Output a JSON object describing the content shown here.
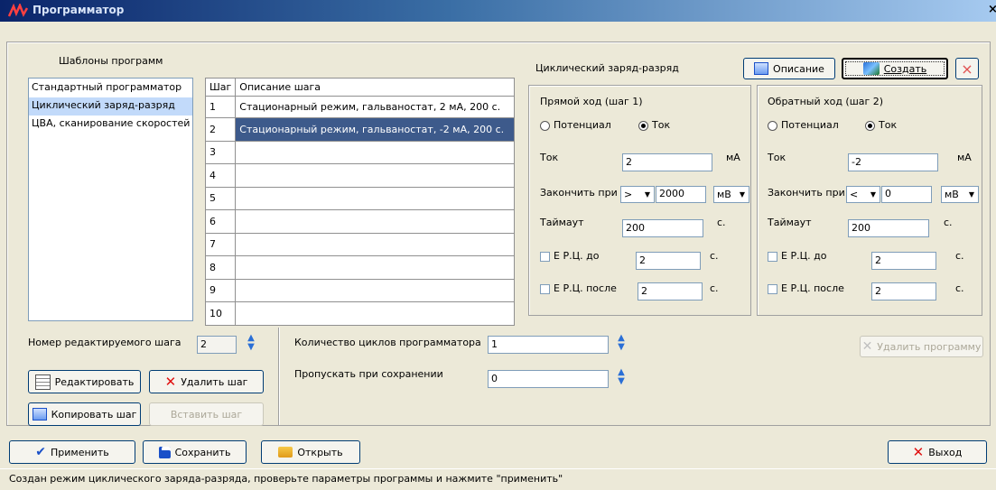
{
  "window": {
    "title": "Программатор"
  },
  "templates": {
    "label": "Шаблоны программ",
    "items": [
      "Стандартный программатор",
      "Циклический заряд-разряд",
      "ЦВА, сканирование скоростей"
    ],
    "selected_index": 1
  },
  "steps": {
    "col_step": "Шаг",
    "col_desc": "Описание шага",
    "rows": [
      {
        "n": "1",
        "desc": "Стационарный режим,  гальваностат, 2 мА, 200 с."
      },
      {
        "n": "2",
        "desc": "Стационарный режим,  гальваностат, -2 мА, 200 с."
      },
      {
        "n": "3",
        "desc": ""
      },
      {
        "n": "4",
        "desc": ""
      },
      {
        "n": "5",
        "desc": ""
      },
      {
        "n": "6",
        "desc": ""
      },
      {
        "n": "7",
        "desc": ""
      },
      {
        "n": "8",
        "desc": ""
      },
      {
        "n": "9",
        "desc": ""
      },
      {
        "n": "10",
        "desc": ""
      }
    ],
    "selected_index": 1
  },
  "program": {
    "name": "Циклический заряд-разряд",
    "describe_label": "Описание",
    "create_label": "Создать"
  },
  "forward": {
    "title": "Прямой ход (шаг 1)",
    "radio_potential": "Потенциал",
    "radio_current": "Ток",
    "current_label": "Ток",
    "current_value": "2",
    "current_unit": "мА",
    "end_label": "Закончить при",
    "end_op": ">",
    "end_value": "2000",
    "end_unit": "мВ",
    "timeout_label": "Таймаут",
    "timeout_value": "200",
    "timeout_unit": "с.",
    "erc_before_label": "Е Р.Ц. до",
    "erc_before_value": "2",
    "erc_before_unit": "с.",
    "erc_after_label": "Е Р.Ц. после",
    "erc_after_value": "2",
    "erc_after_unit": "с."
  },
  "reverse": {
    "title": "Обратный ход (шаг 2)",
    "radio_potential": "Потенциал",
    "radio_current": "Ток",
    "current_label": "Ток",
    "current_value": "-2",
    "current_unit": "мА",
    "end_label": "Закончить при",
    "end_op": "<",
    "end_value": "0",
    "end_unit": "мВ",
    "timeout_label": "Таймаут",
    "timeout_value": "200",
    "timeout_unit": "с.",
    "erc_before_label": "Е Р.Ц. до",
    "erc_before_value": "2",
    "erc_before_unit": "с.",
    "erc_after_label": "Е Р.Ц. после",
    "erc_after_value": "2",
    "erc_after_unit": "с."
  },
  "edit": {
    "step_no_label": "Номер редактируемого шага",
    "step_no_value": "2",
    "edit_btn": "Редактировать",
    "delete_step_btn": "Удалить шаг",
    "copy_step_btn": "Копировать шаг",
    "paste_step_btn": "Вставить шаг"
  },
  "cycles": {
    "count_label": "Количество циклов программатора",
    "count_value": "1",
    "skip_label": "Пропускать при сохранении",
    "skip_value": "0",
    "delete_program_btn": "Удалить программу"
  },
  "bottom": {
    "apply_btn": "Применить",
    "save_btn": "Сохранить",
    "open_btn": "Открыть",
    "exit_btn": "Выход"
  },
  "status": {
    "text": "Создан режим циклического заряда-разряда, проверьте параметры программы и нажмите \"применить\""
  },
  "colors": {
    "selection": "#3d5a8b",
    "accent_red": "#e01010",
    "title_blue": "#0a246a"
  }
}
